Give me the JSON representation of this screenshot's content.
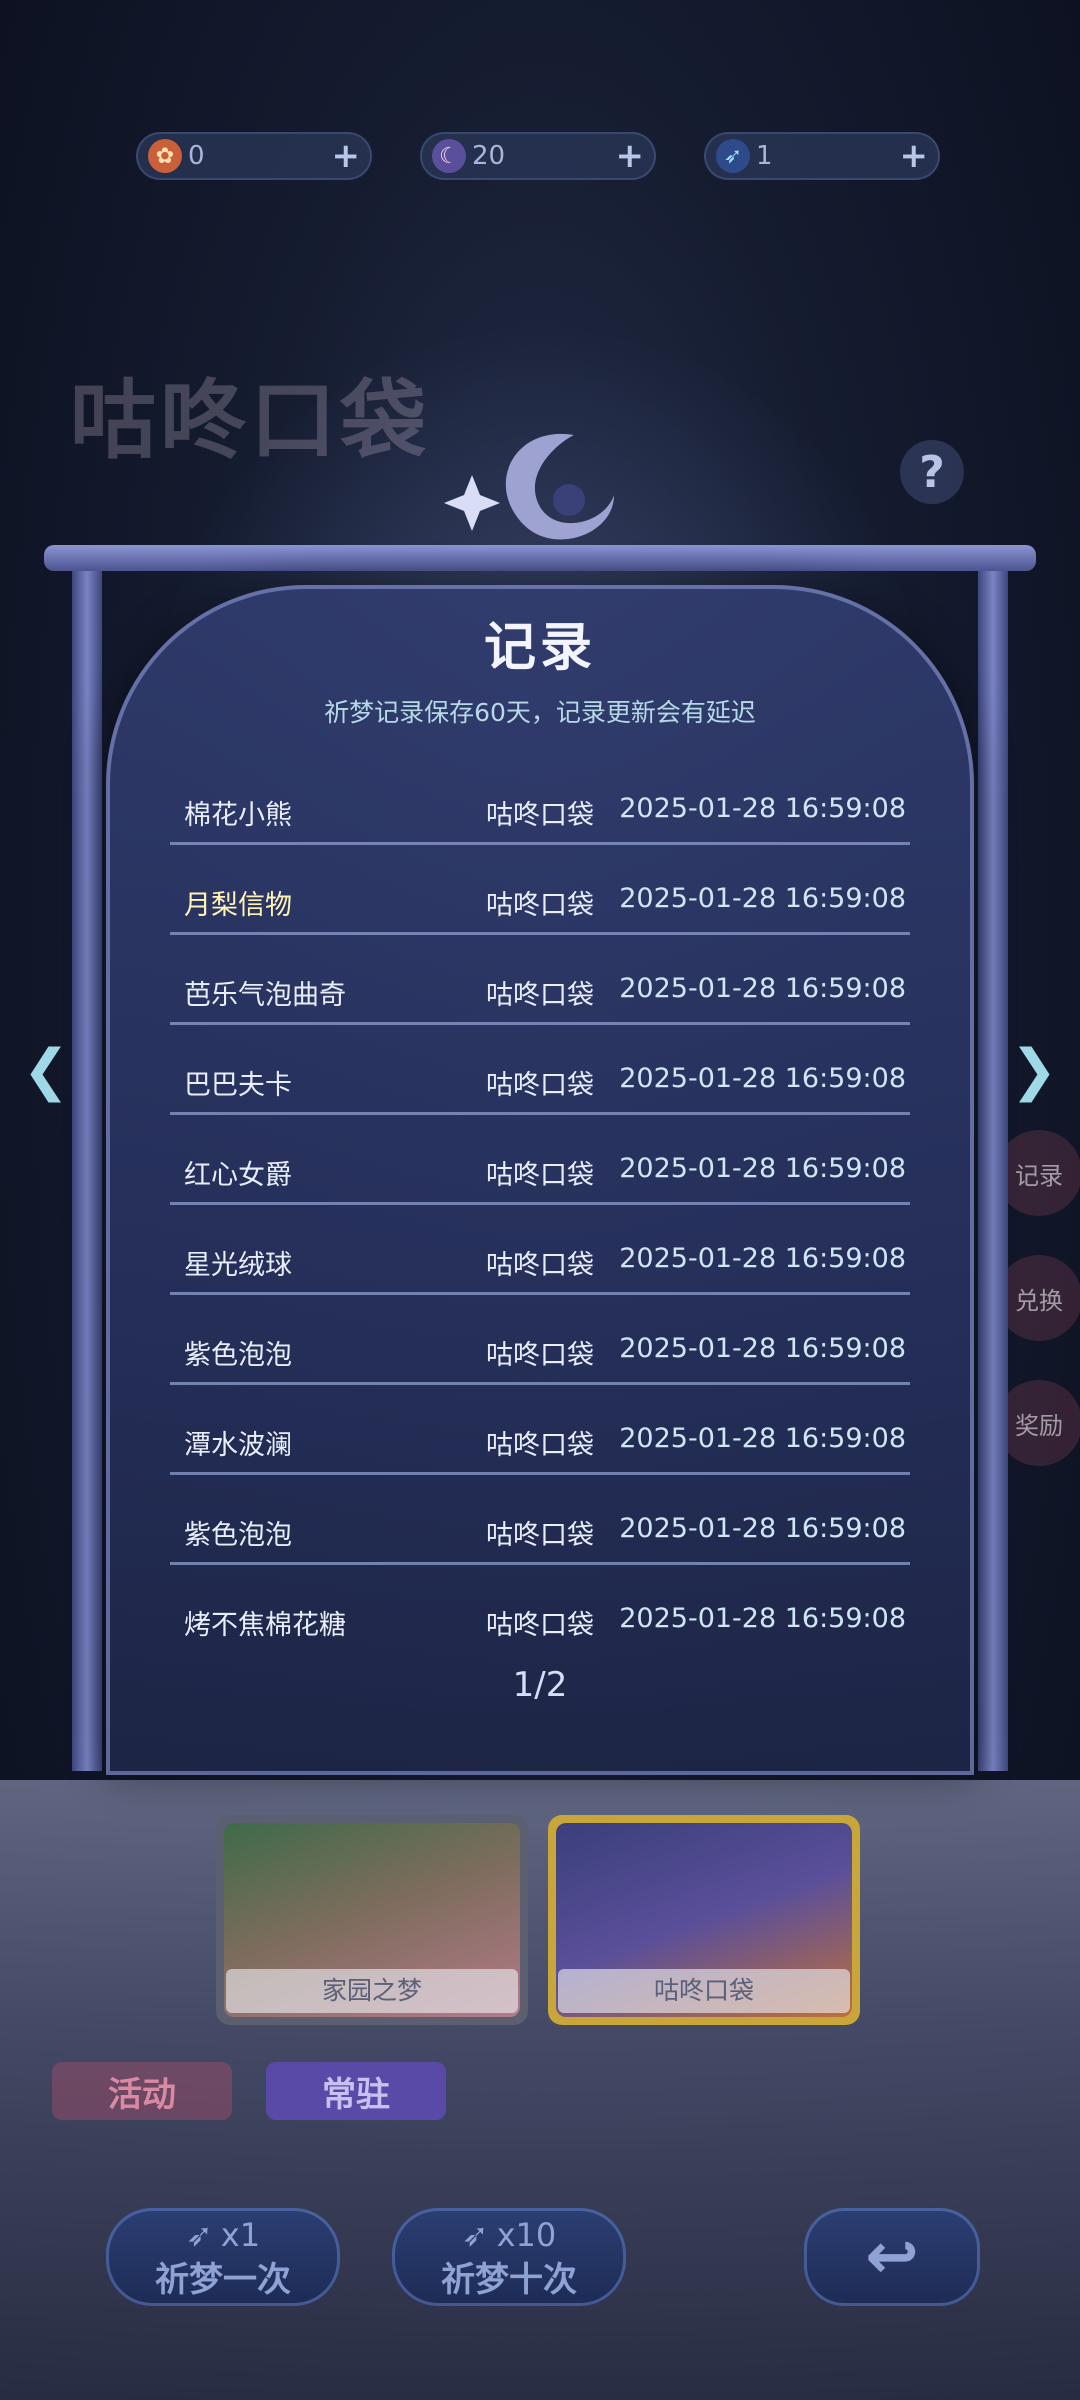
{
  "currency": [
    {
      "icon": "flower-coin-icon",
      "value": "0",
      "plus": "+"
    },
    {
      "icon": "moon-coin-icon",
      "value": "20",
      "plus": "+"
    },
    {
      "icon": "feather-ticket-icon",
      "value": "1",
      "plus": "+"
    }
  ],
  "background": {
    "title": "咕咚口袋",
    "help": "?",
    "side_buttons": [
      "记录",
      "兑换",
      "奖励"
    ]
  },
  "modal": {
    "title": "记录",
    "subtitle": "祈梦记录保存60天，记录更新会有延迟",
    "records": [
      {
        "item": "棉花小熊",
        "source": "咕咚口袋",
        "time": "2025-01-28 16:59:08"
      },
      {
        "item": "月梨信物",
        "source": "咕咚口袋",
        "time": "2025-01-28 16:59:08"
      },
      {
        "item": "芭乐气泡曲奇",
        "source": "咕咚口袋",
        "time": "2025-01-28 16:59:08"
      },
      {
        "item": "巴巴夫卡",
        "source": "咕咚口袋",
        "time": "2025-01-28 16:59:08"
      },
      {
        "item": "红心女爵",
        "source": "咕咚口袋",
        "time": "2025-01-28 16:59:08"
      },
      {
        "item": "星光绒球",
        "source": "咕咚口袋",
        "time": "2025-01-28 16:59:08"
      },
      {
        "item": "紫色泡泡",
        "source": "咕咚口袋",
        "time": "2025-01-28 16:59:08"
      },
      {
        "item": "潭水波澜",
        "source": "咕咚口袋",
        "time": "2025-01-28 16:59:08"
      },
      {
        "item": "紫色泡泡",
        "source": "咕咚口袋",
        "time": "2025-01-28 16:59:08"
      },
      {
        "item": "烤不焦棉花糖",
        "source": "咕咚口袋",
        "time": "2025-01-28 16:59:08"
      }
    ],
    "page": "1/2",
    "prev": "❮",
    "next": "❯"
  },
  "pools": [
    {
      "label": "家园之梦",
      "selected": false
    },
    {
      "label": "咕咚口袋",
      "selected": true
    }
  ],
  "tabs": [
    {
      "label": "活动",
      "color": "#c0506e"
    },
    {
      "label": "常驻",
      "color": "#6a55b8"
    }
  ],
  "actions": {
    "single": {
      "cost": "x1",
      "label": "祈梦一次"
    },
    "ten": {
      "cost": "x10",
      "label": "祈梦十次"
    },
    "back": "↩"
  },
  "colors": {
    "accent_text": "#b6d9e6",
    "highlight_item": "#fff3b5",
    "panel_border": "#8c95d4"
  }
}
